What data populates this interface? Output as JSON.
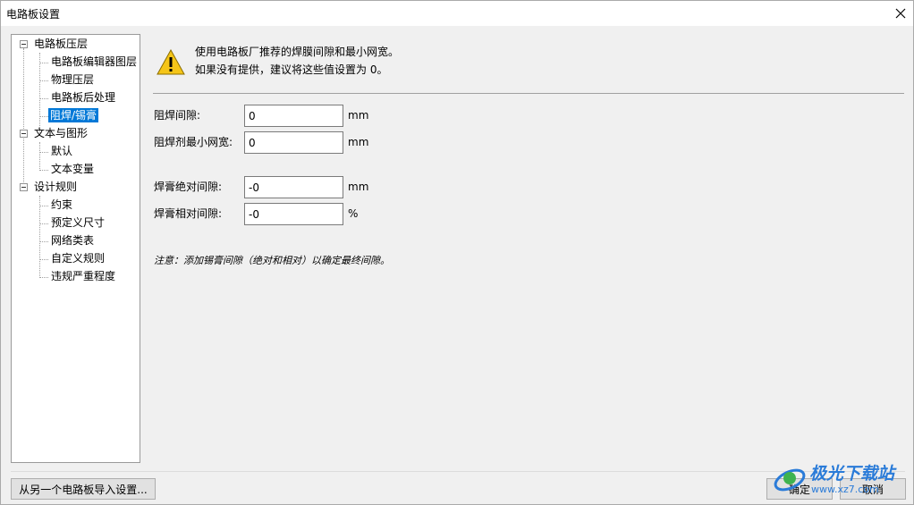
{
  "window": {
    "title": "电路板设置"
  },
  "tree": {
    "items": [
      {
        "label": "电路板压层",
        "level": 0,
        "expanded": true
      },
      {
        "label": "电路板编辑器图层",
        "level": 1
      },
      {
        "label": "物理压层",
        "level": 1
      },
      {
        "label": "电路板后处理",
        "level": 1
      },
      {
        "label": "阻焊/锡膏",
        "level": 1,
        "selected": true
      },
      {
        "label": "文本与图形",
        "level": 0,
        "expanded": true
      },
      {
        "label": "默认",
        "level": 1
      },
      {
        "label": "文本变量",
        "level": 1
      },
      {
        "label": "设计规则",
        "level": 0,
        "expanded": true
      },
      {
        "label": "约束",
        "level": 1
      },
      {
        "label": "预定义尺寸",
        "level": 1
      },
      {
        "label": "网络类表",
        "level": 1
      },
      {
        "label": "自定义规则",
        "level": 1
      },
      {
        "label": "违规严重程度",
        "level": 1
      }
    ]
  },
  "panel": {
    "warning_line1": "使用电路板厂推荐的焊膜间隙和最小网宽。",
    "warning_line2": "如果没有提供，建议将这些值设置为 0。",
    "fields": [
      {
        "label": "阻焊间隙:",
        "value": "0",
        "unit": "mm"
      },
      {
        "label": "阻焊剂最小网宽:",
        "value": "0",
        "unit": "mm"
      },
      {
        "label": "焊膏绝对间隙:",
        "value": "-0",
        "unit": "mm"
      },
      {
        "label": "焊膏相对间隙:",
        "value": "-0",
        "unit": "%"
      }
    ],
    "note": "注意：添加锡膏间隙（绝对和相对）以确定最终间隙。"
  },
  "buttons": {
    "import": "从另一个电路板导入设置...",
    "ok": "确定",
    "cancel": "取消"
  },
  "watermark": {
    "text": "极光下载站",
    "url": "www.xz7.com"
  },
  "colors": {
    "selection": "#0078d7",
    "warning": "#f5c518"
  }
}
